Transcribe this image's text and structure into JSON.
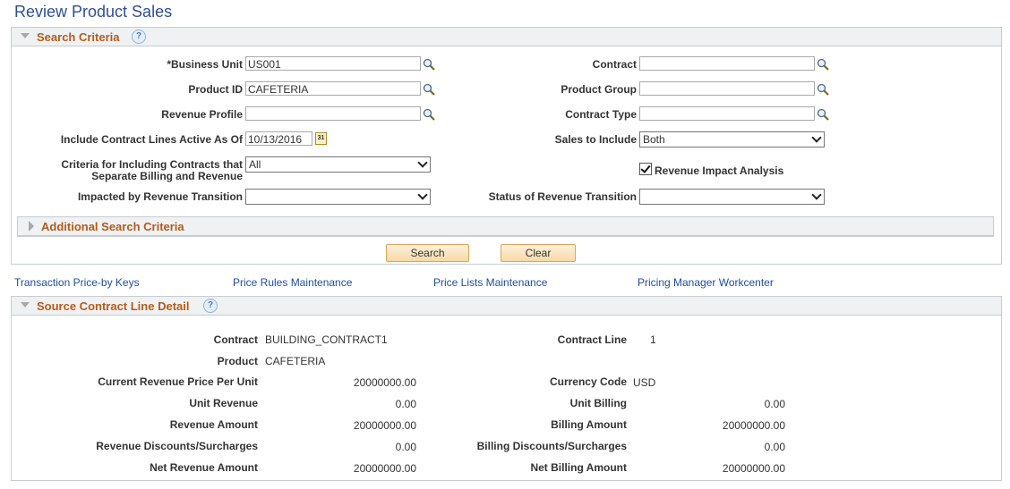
{
  "page": {
    "title": "Review Product Sales"
  },
  "search_criteria": {
    "title": "Search Criteria",
    "help": "?",
    "fields": {
      "business_unit": {
        "label": "*Business Unit",
        "value": "US001"
      },
      "product_id": {
        "label": "Product ID",
        "value": "CAFETERIA"
      },
      "revenue_profile": {
        "label": "Revenue Profile",
        "value": ""
      },
      "active_as_of": {
        "label": "Include Contract Lines Active As Of",
        "value": "10/13/2016"
      },
      "criteria_line1": "Criteria for Including Contracts that",
      "criteria_line2": "Separate Billing and Revenue",
      "criteria_value": "All",
      "impacted": {
        "label": "Impacted by Revenue Transition",
        "value": ""
      },
      "contract": {
        "label": "Contract",
        "value": ""
      },
      "product_group": {
        "label": "Product Group",
        "value": ""
      },
      "contract_type": {
        "label": "Contract Type",
        "value": ""
      },
      "sales_to_include": {
        "label": "Sales to Include",
        "value": "Both"
      },
      "revenue_impact": {
        "label": "Revenue Impact Analysis",
        "checked": true
      },
      "status_transition": {
        "label": "Status of Revenue Transition",
        "value": ""
      }
    },
    "additional": "Additional Search Criteria",
    "search_btn": "Search",
    "clear_btn": "Clear",
    "calendar_glyph": "31"
  },
  "links": [
    "Transaction Price-by Keys",
    "Price Rules Maintenance",
    "Price Lists Maintenance",
    "Pricing Manager Workcenter"
  ],
  "detail": {
    "title": "Source Contract Line Detail",
    "help": "?",
    "left": [
      {
        "label": "Contract",
        "value": "BUILDING_CONTRACT1"
      },
      {
        "label": "Product",
        "value": "CAFETERIA"
      },
      {
        "label": "Current Revenue Price Per Unit",
        "value": "20000000.00"
      },
      {
        "label": "Unit Revenue",
        "value": "0.00"
      },
      {
        "label": "Revenue Amount",
        "value": "20000000.00"
      },
      {
        "label": "Revenue Discounts/Surcharges",
        "value": "0.00"
      },
      {
        "label": "Net Revenue Amount",
        "value": "20000000.00"
      }
    ],
    "right": [
      {
        "label": "Contract Line",
        "value": "1"
      },
      {
        "label": "Currency Code",
        "value": "USD"
      },
      {
        "label": "Unit Billing",
        "value": "0.00"
      },
      {
        "label": "Billing Amount",
        "value": "20000000.00"
      },
      {
        "label": "Billing Discounts/Surcharges",
        "value": "0.00"
      },
      {
        "label": "Net Billing Amount",
        "value": "20000000.00"
      }
    ]
  }
}
